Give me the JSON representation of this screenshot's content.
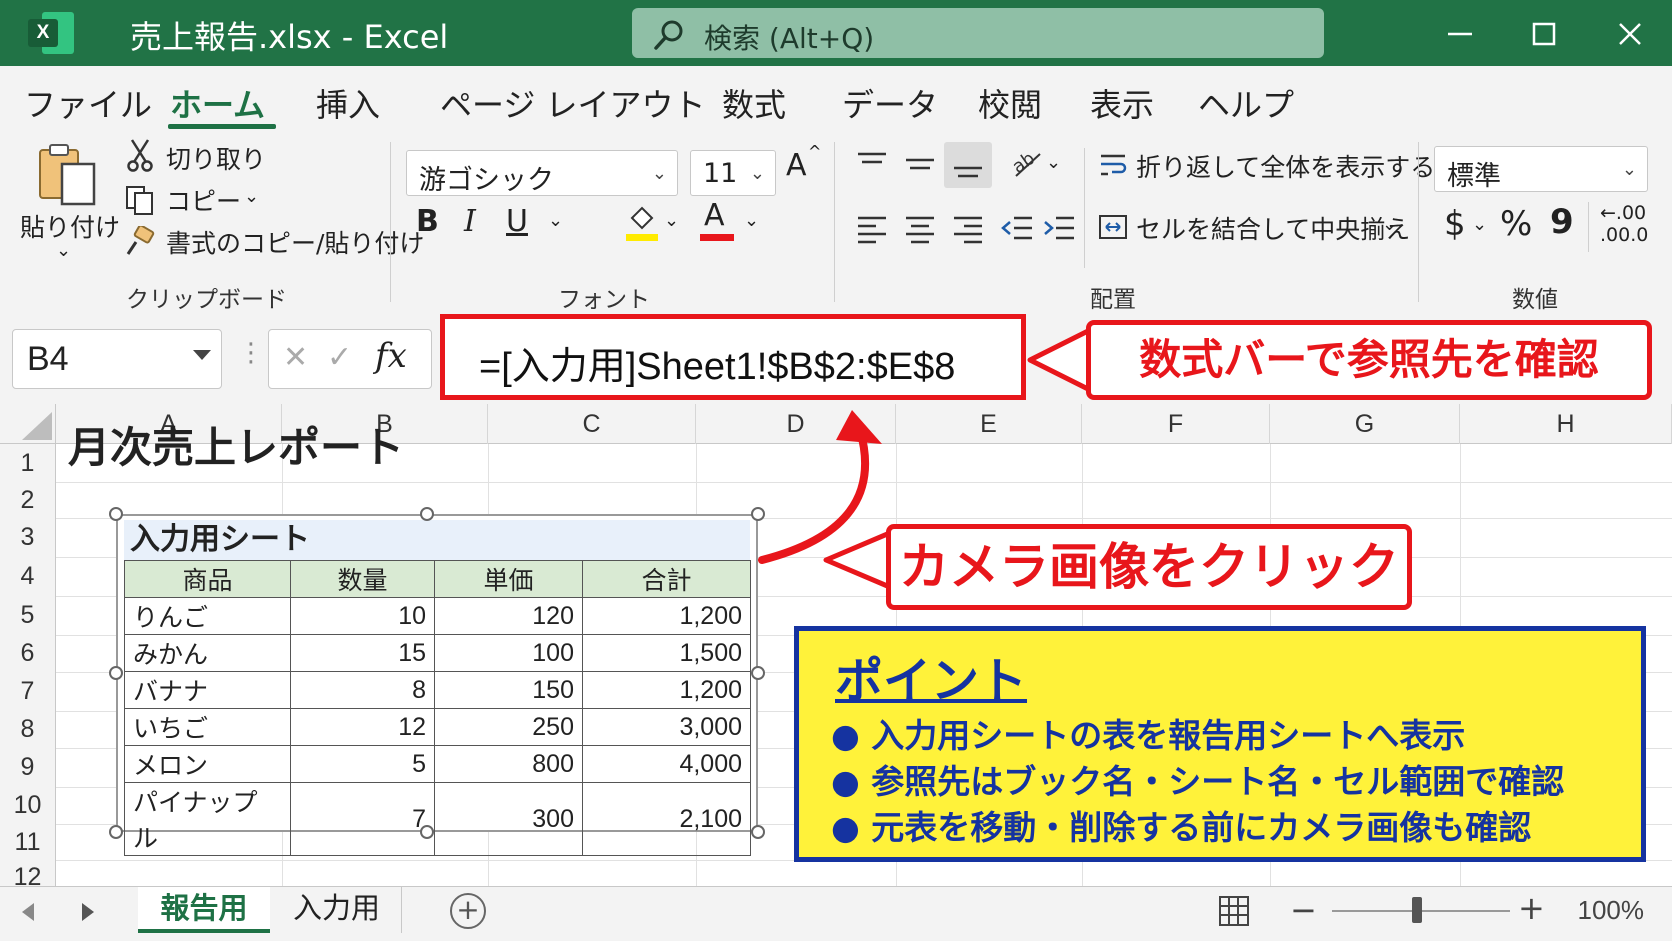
{
  "titlebar": {
    "app_logo_letter": "X",
    "title": "売上報告.xlsx - Excel",
    "search_placeholder": "検索 (Alt+Q)"
  },
  "menu": {
    "tabs": [
      "ファイル",
      "ホーム",
      "挿入",
      "ページ レイアウト",
      "数式",
      "データ",
      "校閲",
      "表示",
      "ヘルプ"
    ],
    "active": "ホーム"
  },
  "ribbon": {
    "clipboard": {
      "paste": "貼り付け",
      "cut": "切り取り",
      "copy": "コピー",
      "format_painter": "書式のコピー/貼り付け",
      "label": "クリップボード"
    },
    "font": {
      "font_name": "游ゴシック",
      "font_size": "11",
      "grow_font": "A",
      "bold": "B",
      "italic": "I",
      "underline": "U",
      "font_color_letter": "A",
      "label": "フォント"
    },
    "alignment": {
      "wrap_text": "折り返して全体を表示する",
      "merge_center": "セルを結合して中央揃え",
      "label": "配置"
    },
    "number": {
      "format": "標準",
      "currency": "$",
      "percent": "%",
      "comma": "9",
      "decimal_top": "←.00",
      "decimal_bottom": ".00.0",
      "label": "数値"
    }
  },
  "formula_bar": {
    "name_box": "B4",
    "cancel": "✕",
    "enter": "✓",
    "fx": "fx",
    "formula": "=[入力用]Sheet1!$B$2:$E$8"
  },
  "callouts": {
    "formula_note": "数式バーで参照先を確認",
    "camera_note": "カメラ画像をクリック"
  },
  "grid": {
    "columns": [
      "A",
      "B",
      "C",
      "D",
      "E",
      "F",
      "G",
      "H"
    ],
    "rows": [
      "1",
      "2",
      "3",
      "4",
      "5",
      "6",
      "7",
      "8",
      "9",
      "10",
      "11",
      "12"
    ],
    "title": "月次売上レポート"
  },
  "camera_image": {
    "title": "入力用シート",
    "headers": [
      "商品",
      "数量",
      "単価",
      "合計"
    ],
    "rows": [
      [
        "りんご",
        "10",
        "120",
        "1,200"
      ],
      [
        "みかん",
        "15",
        "100",
        "1,500"
      ],
      [
        "バナナ",
        "8",
        "150",
        "1,200"
      ],
      [
        "いちご",
        "12",
        "250",
        "3,000"
      ],
      [
        "メロン",
        "5",
        "800",
        "4,000"
      ],
      [
        "パイナップル",
        "7",
        "300",
        "2,100"
      ]
    ]
  },
  "point_box": {
    "title": "ポイント",
    "items": [
      "入力用シートの表を報告用シートへ表示",
      "参照先はブック名・シート名・セル範囲で確認",
      "元表を移動・削除する前にカメラ画像も確認"
    ]
  },
  "sheet_tabs": {
    "tabs": [
      "報告用",
      "入力用"
    ],
    "active": "報告用",
    "add": "+"
  },
  "status": {
    "zoom_minus": "−",
    "zoom_plus": "+",
    "zoom": "100%"
  },
  "colors": {
    "excel_green": "#217346",
    "callout_red": "#e8161b",
    "point_yellow": "#fff23a",
    "point_blue": "#1533a0"
  }
}
